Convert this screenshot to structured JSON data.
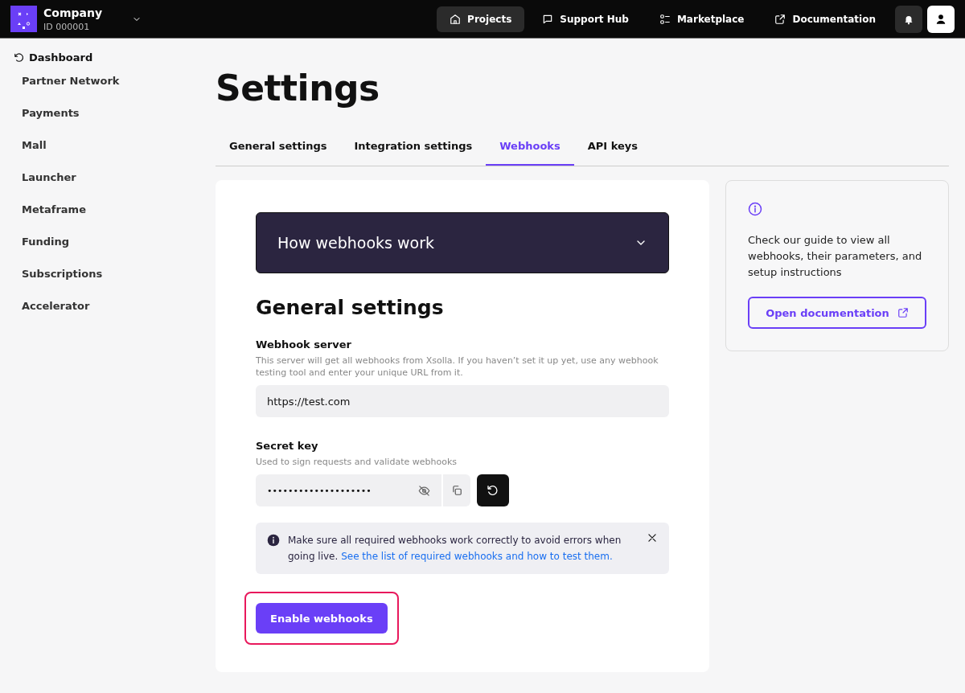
{
  "company": {
    "name": "Company",
    "id": "ID 000001"
  },
  "nav": [
    {
      "label": "Projects",
      "selected": true
    },
    {
      "label": "Support Hub",
      "selected": false
    },
    {
      "label": "Marketplace",
      "selected": false
    },
    {
      "label": "Documentation",
      "selected": false
    }
  ],
  "sidebar": {
    "back": "Dashboard",
    "items": [
      "Partner Network",
      "Payments",
      "Mall",
      "Launcher",
      "Metaframe",
      "Funding",
      "Subscriptions",
      "Accelerator"
    ]
  },
  "title": "Settings",
  "tabs": [
    {
      "label": "General settings",
      "selected": false
    },
    {
      "label": "Integration settings",
      "selected": false
    },
    {
      "label": "Webhooks",
      "selected": true
    },
    {
      "label": "API keys",
      "selected": false
    }
  ],
  "accordion": {
    "title": "How webhooks work",
    "expanded": false
  },
  "section_title": "General settings",
  "webhook_server": {
    "label": "Webhook server",
    "hint": "This server will get all webhooks from Xsolla. If you haven’t set it up yet, use any webhook testing tool and enter your unique URL from it.",
    "value": "https://test.com"
  },
  "secret_key": {
    "label": "Secret key",
    "hint": "Used to sign requests and validate webhooks",
    "value": "••••••••••••••••••••"
  },
  "notice": {
    "text": "Make sure all required webhooks work correctly to avoid errors when going live.",
    "link": "See the list of required webhooks and how to test them."
  },
  "enable_button": {
    "label": "Enable webhooks",
    "highlighted": true
  },
  "guide": {
    "text": "Check our guide to view all webhooks, their parameters, and setup instructions",
    "button": "Open documentation"
  }
}
